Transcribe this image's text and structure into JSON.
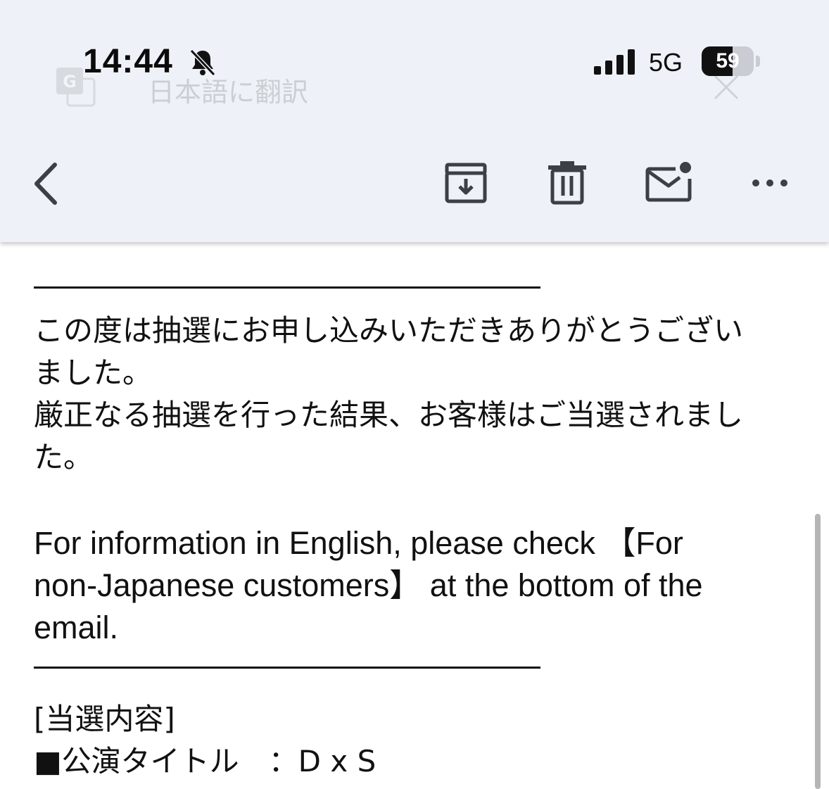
{
  "status_bar": {
    "time": "14:44",
    "network": "5G",
    "battery_level": 59,
    "battery_text": "59",
    "icons": [
      "bell-slash-icon",
      "signal-bars-icon",
      "battery-icon"
    ]
  },
  "translate_bar": {
    "label": "日本語に翻訳",
    "icons": [
      "google-translate-icon",
      "close-icon"
    ]
  },
  "toolbar": {
    "icons": [
      "back-chevron-icon",
      "archive-icon",
      "trash-icon",
      "mark-unread-icon",
      "more-icon"
    ]
  },
  "email": {
    "paragraph1": [
      "この度は抽選にお申し込みいただきありがとうござい",
      "ました。",
      "厳正なる抽選を行った結果、お客様はご当選されまし",
      "た。"
    ],
    "english": [
      "For information in English, please check 【For",
      "non-Japanese customers】 at the bottom of the",
      "email."
    ],
    "section_header": "[当選内容]",
    "detail_line": "■公演タイトル　：D x S"
  },
  "colors": {
    "header_bg": "#eef2f8",
    "icon": "#3c3f44",
    "text": "#111111"
  }
}
